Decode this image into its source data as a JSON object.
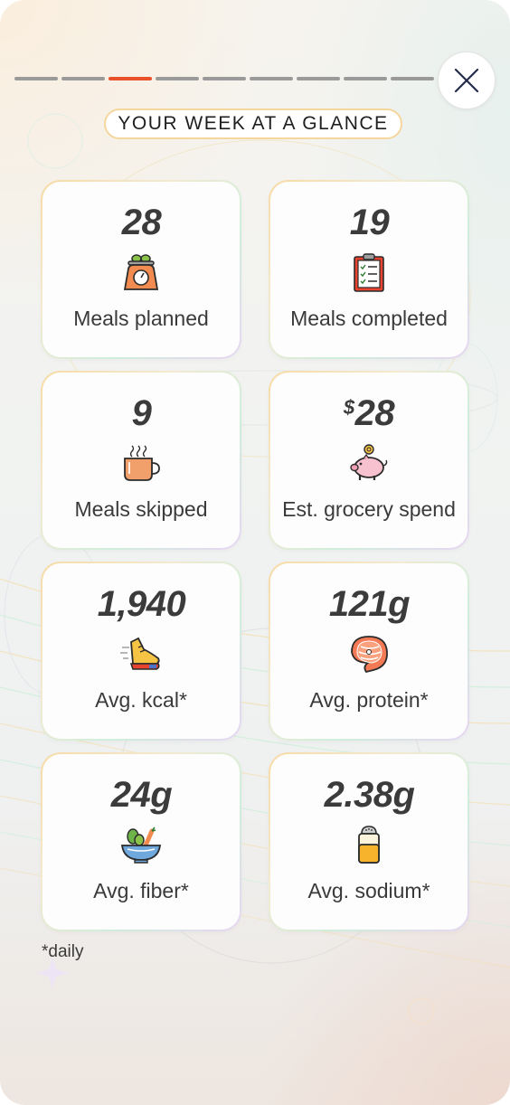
{
  "progress": {
    "segments": 9,
    "active_index": 2,
    "active_color": "#e8512a",
    "inactive_color": "#9a9a9a"
  },
  "close": {
    "icon": "close-icon"
  },
  "heading": "YOUR WEEK AT A GLANCE",
  "cards": [
    {
      "value": "28",
      "prefix": "",
      "label": "Meals planned",
      "icon": "kitchen-scale-icon"
    },
    {
      "value": "19",
      "prefix": "",
      "label": "Meals completed",
      "icon": "clipboard-checklist-icon"
    },
    {
      "value": "9",
      "prefix": "",
      "label": "Meals skipped",
      "icon": "hot-mug-icon"
    },
    {
      "value": "28",
      "prefix": "$",
      "label": "Est. grocery spend",
      "icon": "piggy-bank-icon"
    },
    {
      "value": "1,940",
      "prefix": "",
      "label": "Avg. kcal*",
      "icon": "running-shoe-icon"
    },
    {
      "value": "121g",
      "prefix": "",
      "label": "Avg. protein*",
      "icon": "salmon-steak-icon"
    },
    {
      "value": "24g",
      "prefix": "",
      "label": "Avg. fiber*",
      "icon": "salad-bowl-icon"
    },
    {
      "value": "2.38g",
      "prefix": "",
      "label": "Avg. sodium*",
      "icon": "salt-shaker-icon"
    }
  ],
  "footnote": "*daily",
  "colors": {
    "accent": "#e8512a",
    "pill_border": "#f5d79e",
    "text": "#3a3a3a"
  }
}
